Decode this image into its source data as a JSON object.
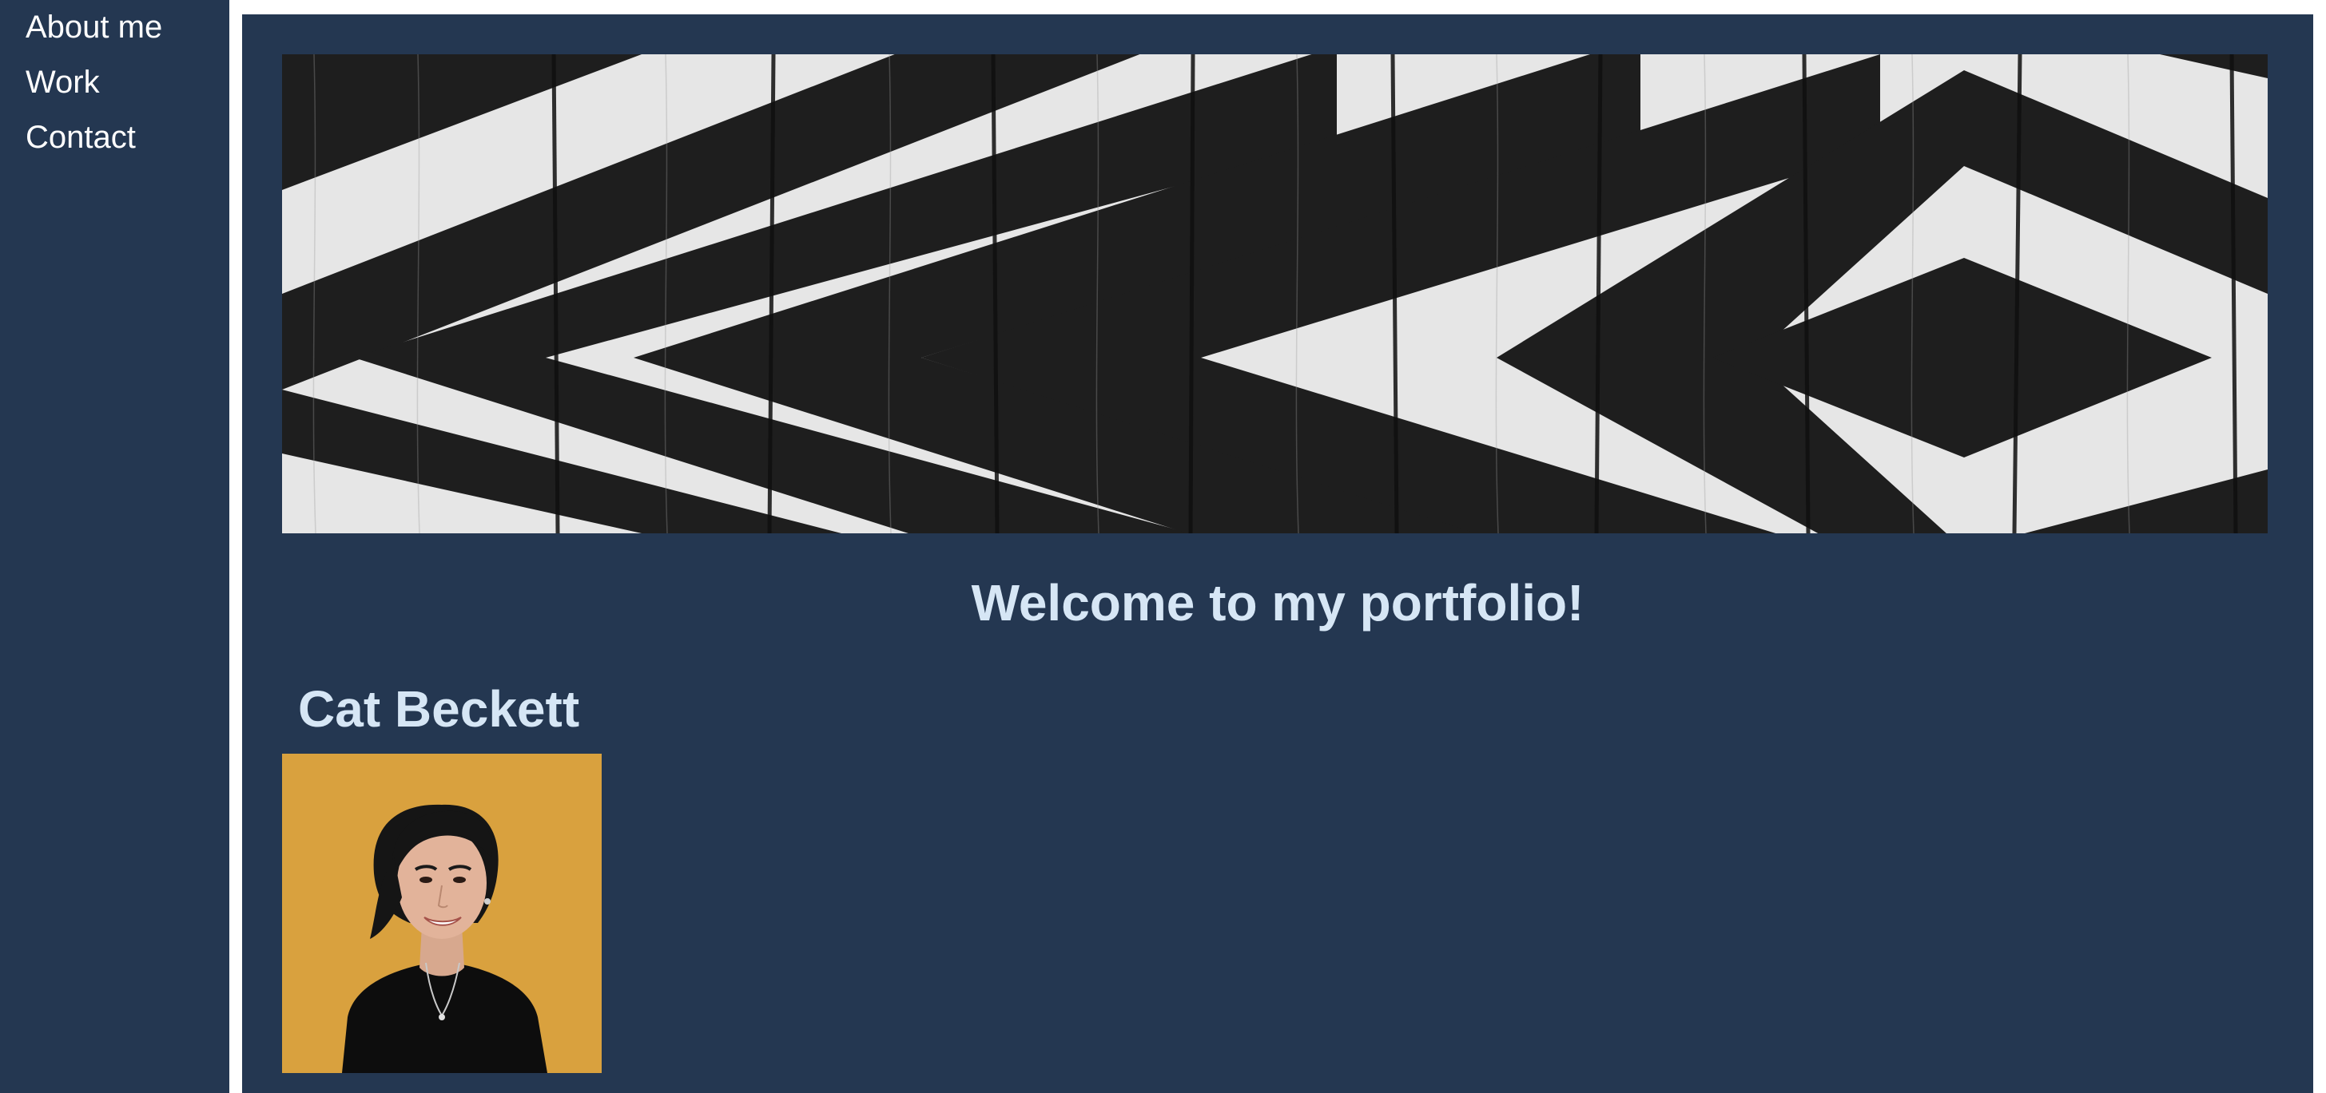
{
  "nav": {
    "about_label": "About me",
    "work_label": "Work",
    "contact_label": "Contact"
  },
  "main": {
    "welcome": "Welcome to my portfolio!",
    "name": "Cat Beckett"
  },
  "colors": {
    "background": "#243751",
    "heading": "#d6e6f5",
    "nav_text": "#ffffff",
    "frame": "#ffffff",
    "portrait_bg": "#d9a13e"
  },
  "images": {
    "banner": "black-white-chevron-painted-wood",
    "portrait": "portrait-photo"
  }
}
